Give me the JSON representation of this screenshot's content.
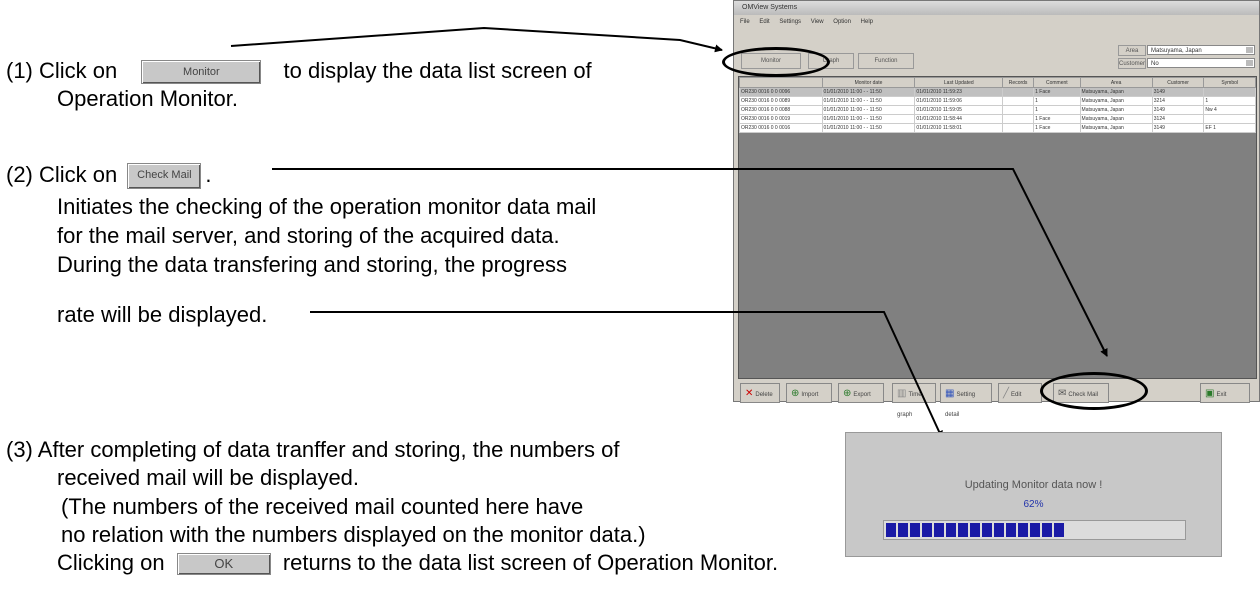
{
  "step1": {
    "prefix": "(1)  Click on",
    "button": "Monitor",
    "suffix": "to display the data list screen of",
    "line2": "Operation Monitor."
  },
  "step2": {
    "prefix": "(2)  Click on",
    "button": "Check Mail",
    "suffix": ".",
    "lines": [
      "Initiates the checking of the operation monitor data mail",
      "for the mail server, and storing of the acquired data.",
      "During the data transfering and storing, the progress",
      "rate will be displayed."
    ]
  },
  "step3": {
    "lines": [
      "(3)  After completing of data tranffer and storing, the numbers of",
      "received mail will be displayed.",
      "(The numbers of the received mail counted here have",
      "no relation with the numbers displayed on the monitor data.)"
    ],
    "ok_prefix": "Clicking on",
    "ok_button": "OK",
    "ok_suffix": "returns to the data list screen of Operation Monitor."
  },
  "window": {
    "title": "OMView Systems",
    "menu": [
      "File",
      "Edit",
      "Settings",
      "View",
      "Option",
      "Help"
    ],
    "tabs": [
      "Monitor",
      "Graph",
      "Function"
    ],
    "area_label": "Area",
    "area_value": "Matsuyama, Japan",
    "customer_label": "Customer",
    "customer_value": "No",
    "columns": [
      "",
      "Monitor date",
      "Last Updated",
      "Records",
      "Comment",
      "Area",
      "Customer",
      "Symbol"
    ],
    "rows": [
      [
        "OR230 0016 0 0 0096",
        "01/01/2010 11:00 - - 11:50",
        "01/01/2010 11:59:23",
        "",
        "1 Face",
        "Matsuyama, Japan",
        "3149",
        ""
      ],
      [
        "OR230 0016 0 0 0089",
        "01/01/2010 11:00 - - 11:50",
        "01/01/2010 11:59:06",
        "",
        "1",
        "Matsuyama, Japan",
        "3214",
        "1"
      ],
      [
        "OR230 0016 0 0 0088",
        "01/01/2010 11:00 - - 11:50",
        "01/01/2010 11:59:05",
        "",
        "1",
        "Matsuyama, Japan",
        "3149",
        "Nw 4"
      ],
      [
        "OR230 0016 0 0 0019",
        "01/01/2010 11:00 - - 11:50",
        "01/01/2010 11:58:44",
        "",
        "1 Face",
        "Matsuyama, Japan",
        "3124",
        ""
      ],
      [
        "OR230 0016 0 0 0016",
        "01/01/2010 11:00 - - 11:50",
        "01/01/2010 11:58:01",
        "",
        "1 Face",
        "Matsuyama, Japan",
        "3149",
        "EF 1"
      ]
    ],
    "buttons": [
      "Delete",
      "Import",
      "Export",
      "Time graph",
      "Setting detail",
      "Edit",
      "Check Mail",
      "Exit"
    ]
  },
  "progress": {
    "message": "Updating Monitor data now !",
    "percent_text": "62%",
    "percent": 62
  }
}
